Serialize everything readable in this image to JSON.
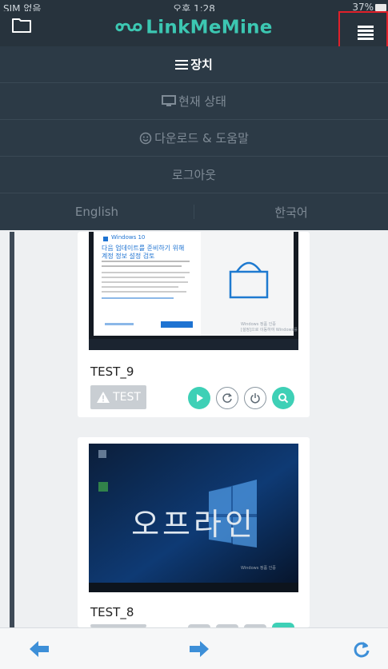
{
  "status": {
    "carrier": "SIM 없음",
    "time": "오후 1:28",
    "battery": "37%"
  },
  "header": {
    "logo": "LinkMeMine"
  },
  "menu": {
    "items": [
      {
        "label": "장치",
        "icon": "list-icon",
        "active": true
      },
      {
        "label": "현재 상태",
        "icon": "monitor-icon",
        "active": false
      },
      {
        "label": "다운로드 & 도움말",
        "icon": "smiley-icon",
        "active": false
      },
      {
        "label": "로그아웃",
        "icon": "",
        "active": false
      }
    ],
    "languages": [
      "English",
      "한국어"
    ]
  },
  "devices": [
    {
      "name": "TEST_9",
      "badge": "TEST",
      "screen": {
        "windows_label": "Windows 10",
        "heading_line1": "다음 업데이트를 준비하기 위해",
        "heading_line2": "계정 정보 설정 검토",
        "watermark_line1": "Windows 정품 인증",
        "watermark_line2": "[설정]으로 이동하여 Windows를"
      }
    },
    {
      "name": "TEST_8",
      "screen": {
        "offline_text": "오프라인",
        "watermark_line1": "Windows 정품 인증"
      }
    }
  ],
  "colors": {
    "accent": "#3cc7b2",
    "header_bg": "#27333d",
    "menu_bg": "#2c3a46",
    "highlight": "#e0202a",
    "nav_blue": "#3d8fd8"
  }
}
